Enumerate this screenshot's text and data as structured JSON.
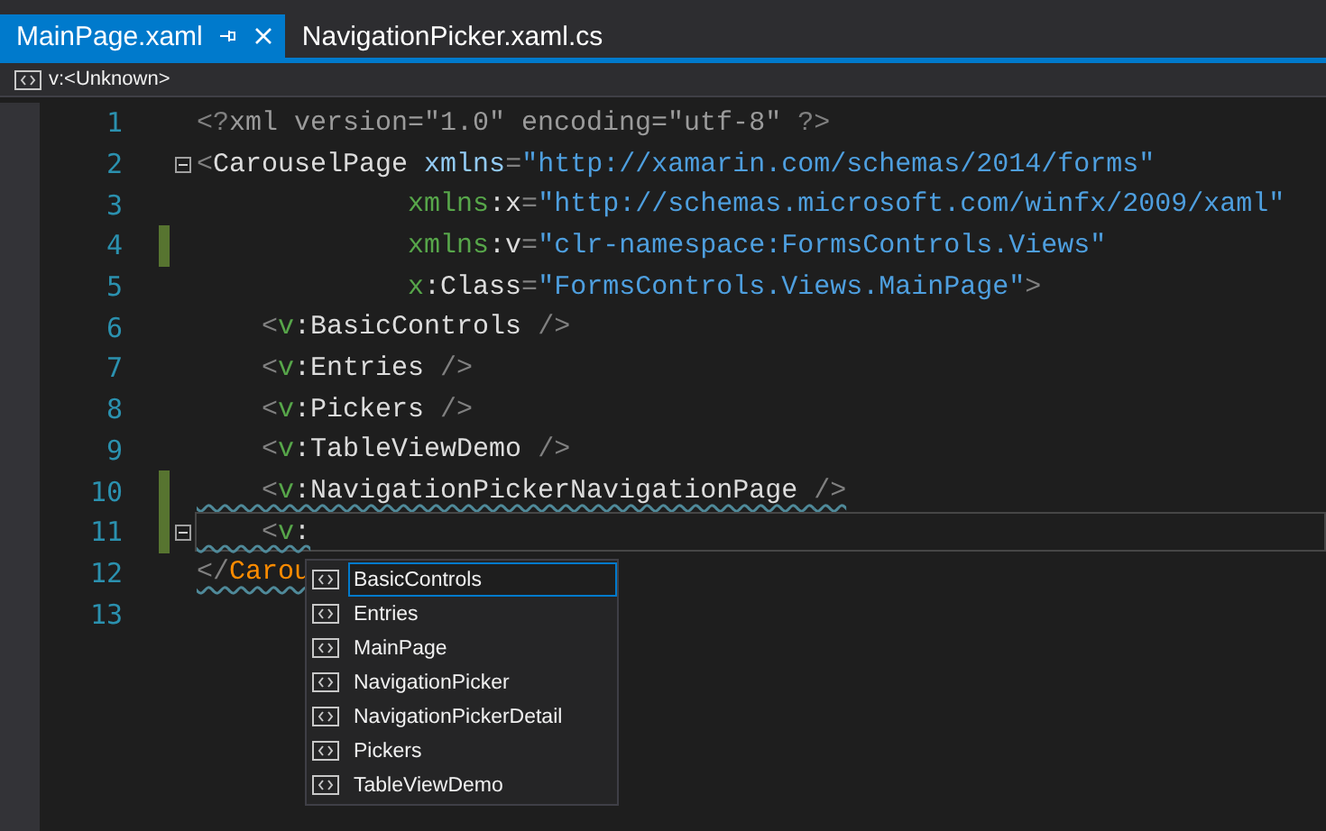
{
  "tabs": [
    {
      "label": "MainPage.xaml",
      "selected": true
    },
    {
      "label": "NavigationPicker.xaml.cs",
      "selected": false
    }
  ],
  "navigation_bar": {
    "label": "v:<Unknown>"
  },
  "editor": {
    "lines": [
      {
        "number": "1",
        "changed": false,
        "collapsible": false,
        "current": false,
        "squiggle": false,
        "tokens": [
          {
            "text": "<?",
            "kind": "punct"
          },
          {
            "text": "xml version=\"1.0\" encoding=\"utf-8\" ",
            "kind": "pi"
          },
          {
            "text": "?>",
            "kind": "punct"
          }
        ]
      },
      {
        "number": "2",
        "changed": false,
        "collapsible": true,
        "current": false,
        "squiggle": false,
        "tokens": [
          {
            "text": "<",
            "kind": "punct"
          },
          {
            "text": "CarouselPage",
            "kind": "element"
          },
          {
            "text": " xmlns",
            "kind": "attribute"
          },
          {
            "text": "=",
            "kind": "punct"
          },
          {
            "text": "\"http://xamarin.com/schemas/2014/forms\"",
            "kind": "value"
          }
        ]
      },
      {
        "number": "3",
        "changed": false,
        "collapsible": false,
        "current": false,
        "squiggle": false,
        "tokens": [
          {
            "text": "             xmlns",
            "kind": "prefix"
          },
          {
            "text": ":x",
            "kind": "element"
          },
          {
            "text": "=",
            "kind": "punct"
          },
          {
            "text": "\"http://schemas.microsoft.com/winfx/2009/xaml\"",
            "kind": "value"
          }
        ]
      },
      {
        "number": "4",
        "changed": true,
        "collapsible": false,
        "current": false,
        "squiggle": false,
        "tokens": [
          {
            "text": "             xmlns",
            "kind": "prefix"
          },
          {
            "text": ":v",
            "kind": "element"
          },
          {
            "text": "=",
            "kind": "punct"
          },
          {
            "text": "\"clr-namespace:FormsControls.Views\"",
            "kind": "value"
          }
        ]
      },
      {
        "number": "5",
        "changed": false,
        "collapsible": false,
        "current": false,
        "squiggle": false,
        "tokens": [
          {
            "text": "             x",
            "kind": "prefix"
          },
          {
            "text": ":Class",
            "kind": "element"
          },
          {
            "text": "=",
            "kind": "punct"
          },
          {
            "text": "\"FormsControls.Views.MainPage\"",
            "kind": "value"
          },
          {
            "text": ">",
            "kind": "punct"
          }
        ]
      },
      {
        "number": "6",
        "changed": false,
        "collapsible": false,
        "current": false,
        "squiggle": false,
        "tokens": [
          {
            "text": "    <",
            "kind": "punct"
          },
          {
            "text": "v",
            "kind": "prefix"
          },
          {
            "text": ":BasicControls ",
            "kind": "element"
          },
          {
            "text": "/>",
            "kind": "punct"
          }
        ]
      },
      {
        "number": "7",
        "changed": false,
        "collapsible": false,
        "current": false,
        "squiggle": false,
        "tokens": [
          {
            "text": "    <",
            "kind": "punct"
          },
          {
            "text": "v",
            "kind": "prefix"
          },
          {
            "text": ":Entries ",
            "kind": "element"
          },
          {
            "text": "/>",
            "kind": "punct"
          }
        ]
      },
      {
        "number": "8",
        "changed": false,
        "collapsible": false,
        "current": false,
        "squiggle": false,
        "tokens": [
          {
            "text": "    <",
            "kind": "punct"
          },
          {
            "text": "v",
            "kind": "prefix"
          },
          {
            "text": ":Pickers ",
            "kind": "element"
          },
          {
            "text": "/>",
            "kind": "punct"
          }
        ]
      },
      {
        "number": "9",
        "changed": false,
        "collapsible": false,
        "current": false,
        "squiggle": false,
        "tokens": [
          {
            "text": "    <",
            "kind": "punct"
          },
          {
            "text": "v",
            "kind": "prefix"
          },
          {
            "text": ":TableViewDemo ",
            "kind": "element"
          },
          {
            "text": "/>",
            "kind": "punct"
          }
        ]
      },
      {
        "number": "10",
        "changed": true,
        "collapsible": false,
        "current": false,
        "squiggle": true,
        "tokens": [
          {
            "text": "    <",
            "kind": "punct"
          },
          {
            "text": "v",
            "kind": "prefix"
          },
          {
            "text": ":NavigationPickerNavigationPage ",
            "kind": "element"
          },
          {
            "text": "/>",
            "kind": "punct"
          }
        ]
      },
      {
        "number": "11",
        "changed": true,
        "collapsible": true,
        "current": true,
        "squiggle": true,
        "tokens": [
          {
            "text": "    <",
            "kind": "punct"
          },
          {
            "text": "v",
            "kind": "prefix"
          },
          {
            "text": ":",
            "kind": "element"
          }
        ]
      },
      {
        "number": "12",
        "changed": false,
        "collapsible": false,
        "current": false,
        "squiggle": true,
        "tokens": [
          {
            "text": "</",
            "kind": "punct"
          },
          {
            "text": "Carou",
            "kind": "error"
          }
        ]
      },
      {
        "number": "13",
        "changed": false,
        "collapsible": false,
        "current": false
      }
    ]
  },
  "completion_list": {
    "items": [
      {
        "label": "BasicControls",
        "selected": true
      },
      {
        "label": "Entries",
        "selected": false
      },
      {
        "label": "MainPage",
        "selected": false
      },
      {
        "label": "NavigationPicker",
        "selected": false
      },
      {
        "label": "NavigationPickerDetail",
        "selected": false
      },
      {
        "label": "Pickers",
        "selected": false
      },
      {
        "label": "TableViewDemo",
        "selected": false
      }
    ]
  }
}
